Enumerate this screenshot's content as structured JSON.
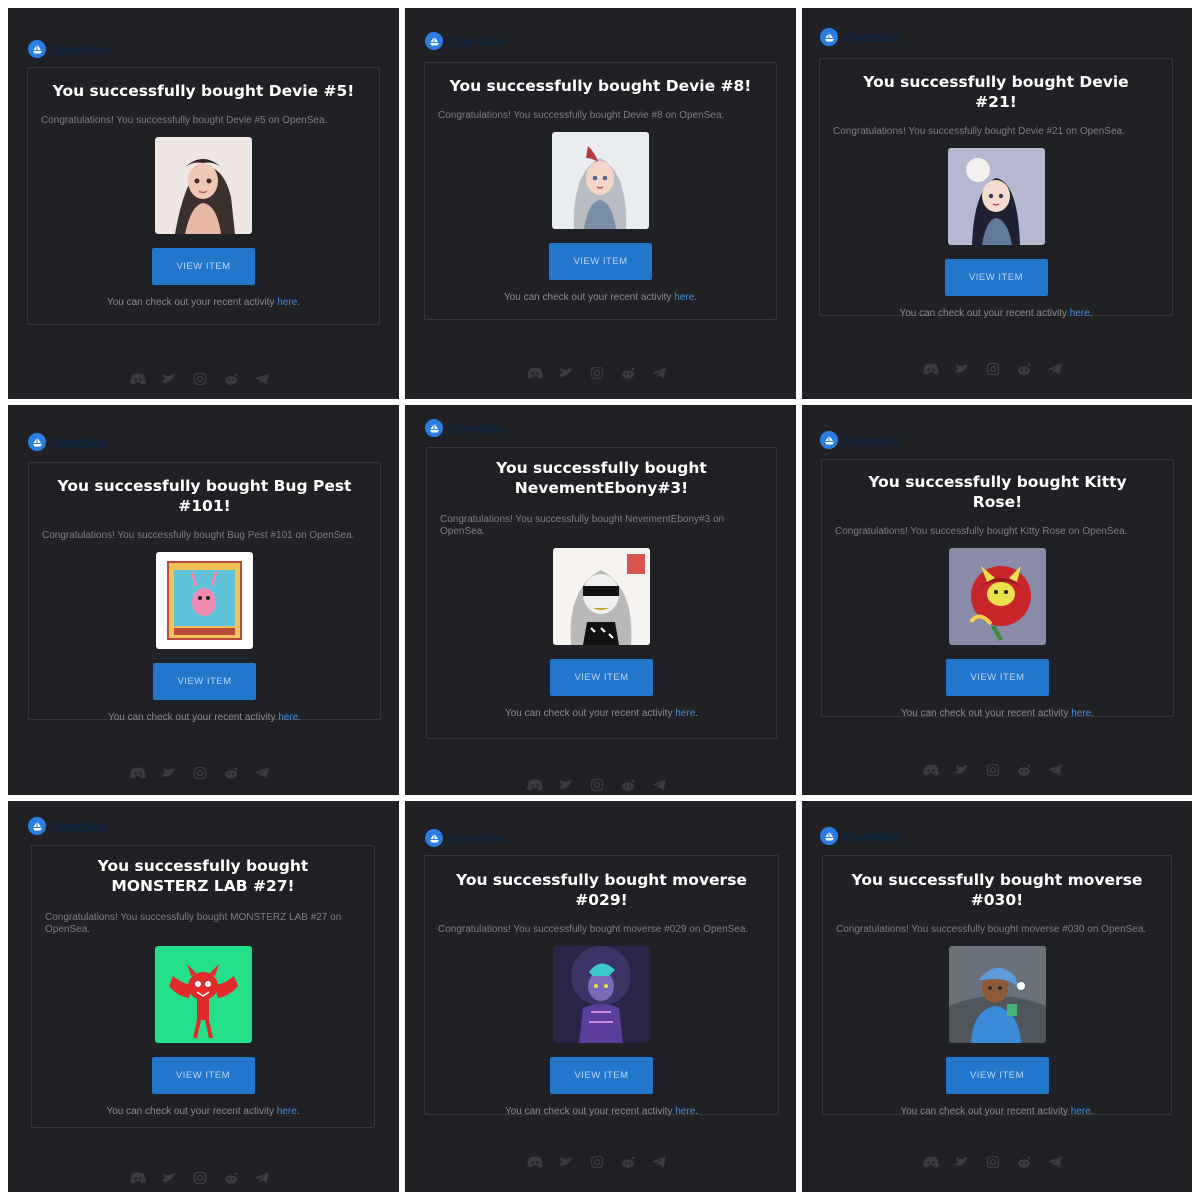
{
  "brand": {
    "name": "OpenSea",
    "accent": "#2276cc",
    "link_color": "#3d8fe0",
    "panel_bg": "#202124"
  },
  "social_icons": [
    "discord-icon",
    "twitter-icon",
    "instagram-icon",
    "reddit-icon",
    "telegram-icon"
  ],
  "emails": [
    {
      "title": "You successfully bought Devie #5!",
      "congrats": "Congratulations! You successfully bought Devie #5 on OpenSea.",
      "button": "VIEW ITEM",
      "activity_prefix": "You can check out your recent activity ",
      "activity_link": "here",
      "activity_suffix": "."
    },
    {
      "title": "You successfully bought Devie #8!",
      "congrats": "Congratulations! You successfully bought Devie #8 on OpenSea.",
      "button": "VIEW ITEM",
      "activity_prefix": "You can check out your recent activity ",
      "activity_link": "here",
      "activity_suffix": "."
    },
    {
      "title": "You successfully bought Devie #21!",
      "congrats": "Congratulations! You successfully bought Devie #21 on OpenSea.",
      "button": "VIEW ITEM",
      "activity_prefix": "You can check out your recent activity ",
      "activity_link": "here",
      "activity_suffix": "."
    },
    {
      "title": "You successfully bought Bug Pest #101!",
      "congrats": "Congratulations! You successfully bought Bug Pest #101 on OpenSea.",
      "button": "VIEW ITEM",
      "activity_prefix": "You can check out your recent activity ",
      "activity_link": "here",
      "activity_suffix": "."
    },
    {
      "title": "You successfully bought NevementEbony#3!",
      "congrats": "Congratulations! You successfully bought NevementEbony#3 on OpenSea.",
      "button": "VIEW ITEM",
      "activity_prefix": "You can check out your recent activity ",
      "activity_link": "here",
      "activity_suffix": "."
    },
    {
      "title": "You successfully bought Kitty Rose!",
      "congrats": "Congratulations! You successfully bought Kitty Rose on OpenSea.",
      "button": "VIEW ITEM",
      "activity_prefix": "You can check out your recent activity ",
      "activity_link": "here",
      "activity_suffix": "."
    },
    {
      "title": "You successfully bought MONSTERZ LAB #27!",
      "congrats": "Congratulations! You successfully bought MONSTERZ LAB #27 on OpenSea.",
      "button": "VIEW ITEM",
      "activity_prefix": "You can check out your recent activity ",
      "activity_link": "here",
      "activity_suffix": "."
    },
    {
      "title": "You successfully bought moverse #029!",
      "congrats": "Congratulations! You successfully bought moverse #029 on OpenSea.",
      "button": "VIEW ITEM",
      "activity_prefix": "You can check out your recent activity ",
      "activity_link": "here",
      "activity_suffix": "."
    },
    {
      "title": "You successfully bought moverse #030!",
      "congrats": "Congratulations! You successfully bought moverse #030 on OpenSea.",
      "button": "VIEW ITEM",
      "activity_prefix": "You can check out your recent activity ",
      "activity_link": "here",
      "activity_suffix": "."
    }
  ]
}
